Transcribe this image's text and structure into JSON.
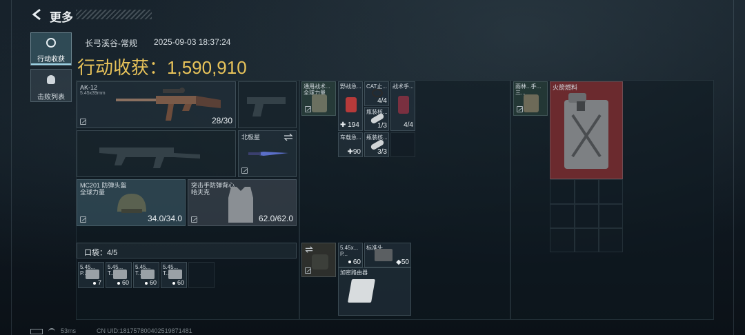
{
  "header": {
    "back_label": "更多"
  },
  "tabs": [
    {
      "label": "行动收获",
      "active": true
    },
    {
      "label": "击败列表",
      "active": false
    }
  ],
  "session": {
    "map": "长弓溪谷-常规",
    "datetime": "2025-09-03 18:37:24"
  },
  "harvest": {
    "label": "行动收获：",
    "value": "1,590,910"
  },
  "weapons": {
    "primary": {
      "name": "AK-12",
      "ammo_type": "5.45x39mm",
      "ammo": "28/30"
    },
    "melee": {
      "name": "北极星"
    }
  },
  "armor": {
    "helmet": {
      "name": "MC201 防弹头盔",
      "sub": "全球力量",
      "durability": "34.0/34.0"
    },
    "vest": {
      "name": "突击手防弹背心",
      "sub": "哈夫克",
      "durability": "62.0/62.0"
    }
  },
  "pocket": {
    "label": "口袋：4/5",
    "items": [
      {
        "name": "5.45...",
        "sub": "P...",
        "count": "7"
      },
      {
        "name": "5.45...",
        "sub": "T...",
        "count": "60"
      },
      {
        "name": "5.45...",
        "sub": "T...",
        "count": "60"
      },
      {
        "name": "5.45...",
        "sub": "T...",
        "count": "60"
      }
    ]
  },
  "chest_rig": {
    "items": [
      {
        "name": "通用战术...",
        "sub": "全球力量"
      },
      {
        "name": "野战急...",
        "count": "194"
      },
      {
        "name": "CAT止...",
        "count": "4/4"
      },
      {
        "name": "战术手...",
        "count": "4/4"
      },
      {
        "name": "瓶装核...",
        "count": "1/3"
      },
      {
        "name": "车载急...",
        "count": "90"
      },
      {
        "name": "瓶装核...",
        "count": "3/3"
      }
    ]
  },
  "backpack": {
    "items": [
      {
        "name": "5.45x...",
        "sub": "P...",
        "count": "60"
      },
      {
        "name": "标准头...",
        "count": "50"
      },
      {
        "name": "加密路由器"
      }
    ]
  },
  "safebox": {
    "items": [
      {
        "name": "雨林...手...",
        "sub": "三..."
      },
      {
        "name": "火箭燃料"
      }
    ]
  },
  "footer": {
    "ping": "53ms",
    "uid": "CN UID:181757800402519871481"
  },
  "colors": {
    "gold": "#e8c35a",
    "rocket_fuel_bg": "#6b2a2e",
    "active_tab": "#2f4a55"
  }
}
